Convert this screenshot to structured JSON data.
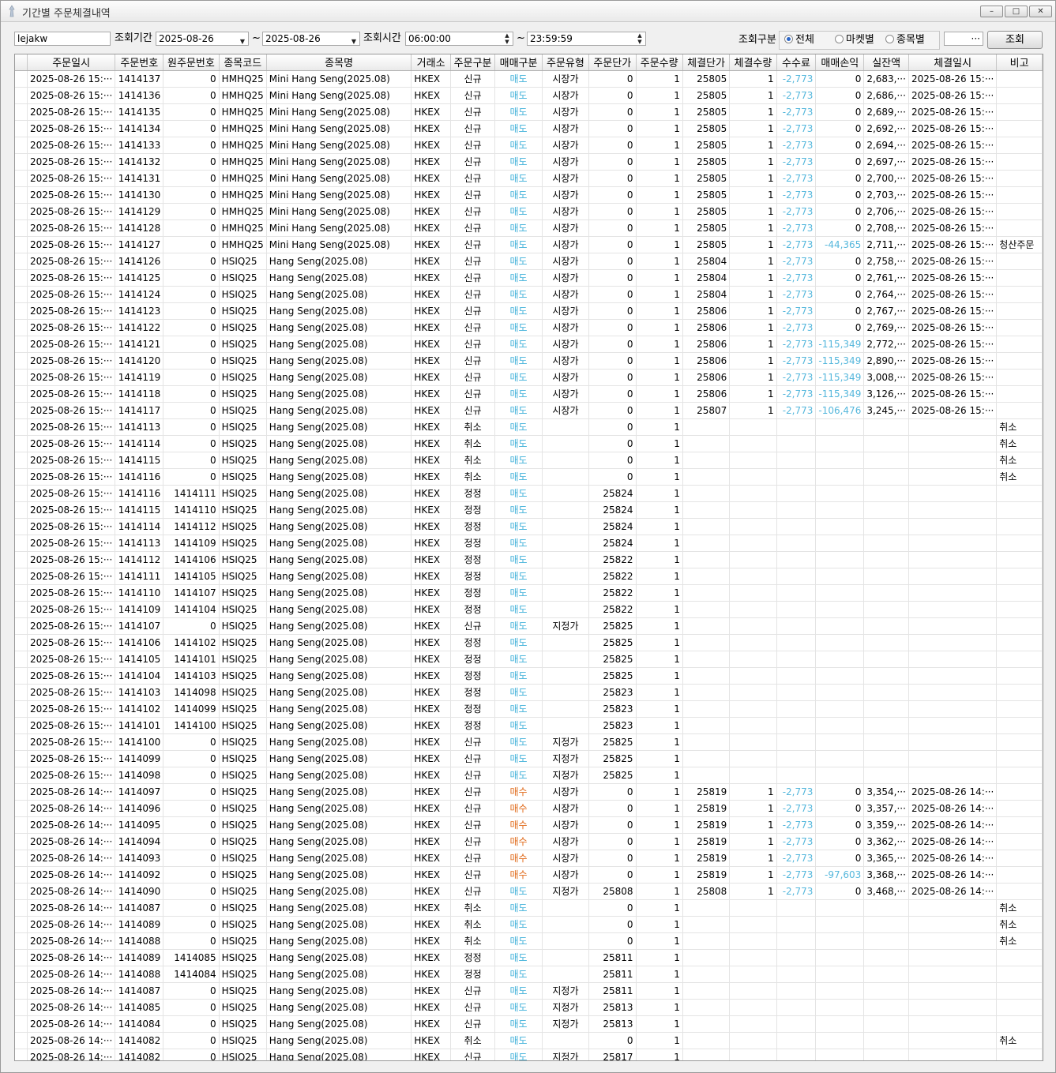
{
  "window": {
    "title": "기간별 주문체결내역",
    "controls": [
      "–",
      "□",
      "✕"
    ]
  },
  "toolbar": {
    "account": "lejakw",
    "period_label": "조회기간",
    "date_from": "2025-08-26",
    "tilde": "~",
    "date_to": "2025-08-26",
    "time_label": "조회시간",
    "time_from": "06:00:00",
    "time_to": "23:59:59",
    "mode_label": "조회구분",
    "mode_options": [
      "전체",
      "마켓별",
      "종목별"
    ],
    "mode_selected": "전체",
    "ellipsis": "···",
    "query_button": "조회"
  },
  "grid": {
    "columns": [
      "주문일시",
      "주문번호",
      "원주문번호",
      "종목코드",
      "종목명",
      "거래소",
      "주문구분",
      "매매구분",
      "주문유형",
      "주문단가",
      "주문수량",
      "체결단가",
      "체결수량",
      "수수료",
      "매매손익",
      "실잔액",
      "체결일시",
      "비고"
    ],
    "rows": [
      [
        "2025-08-26 15:···",
        "1414137",
        "0",
        "HMHQ25",
        "Mini Hang Seng(2025.08)",
        "HKEX",
        "신규",
        "매도",
        "시장가",
        "0",
        "1",
        "25805",
        "1",
        "-2,773",
        "0",
        "2,683,···",
        "2025-08-26 15:···",
        ""
      ],
      [
        "2025-08-26 15:···",
        "1414136",
        "0",
        "HMHQ25",
        "Mini Hang Seng(2025.08)",
        "HKEX",
        "신규",
        "매도",
        "시장가",
        "0",
        "1",
        "25805",
        "1",
        "-2,773",
        "0",
        "2,686,···",
        "2025-08-26 15:···",
        ""
      ],
      [
        "2025-08-26 15:···",
        "1414135",
        "0",
        "HMHQ25",
        "Mini Hang Seng(2025.08)",
        "HKEX",
        "신규",
        "매도",
        "시장가",
        "0",
        "1",
        "25805",
        "1",
        "-2,773",
        "0",
        "2,689,···",
        "2025-08-26 15:···",
        ""
      ],
      [
        "2025-08-26 15:···",
        "1414134",
        "0",
        "HMHQ25",
        "Mini Hang Seng(2025.08)",
        "HKEX",
        "신규",
        "매도",
        "시장가",
        "0",
        "1",
        "25805",
        "1",
        "-2,773",
        "0",
        "2,692,···",
        "2025-08-26 15:···",
        ""
      ],
      [
        "2025-08-26 15:···",
        "1414133",
        "0",
        "HMHQ25",
        "Mini Hang Seng(2025.08)",
        "HKEX",
        "신규",
        "매도",
        "시장가",
        "0",
        "1",
        "25805",
        "1",
        "-2,773",
        "0",
        "2,694,···",
        "2025-08-26 15:···",
        ""
      ],
      [
        "2025-08-26 15:···",
        "1414132",
        "0",
        "HMHQ25",
        "Mini Hang Seng(2025.08)",
        "HKEX",
        "신규",
        "매도",
        "시장가",
        "0",
        "1",
        "25805",
        "1",
        "-2,773",
        "0",
        "2,697,···",
        "2025-08-26 15:···",
        ""
      ],
      [
        "2025-08-26 15:···",
        "1414131",
        "0",
        "HMHQ25",
        "Mini Hang Seng(2025.08)",
        "HKEX",
        "신규",
        "매도",
        "시장가",
        "0",
        "1",
        "25805",
        "1",
        "-2,773",
        "0",
        "2,700,···",
        "2025-08-26 15:···",
        ""
      ],
      [
        "2025-08-26 15:···",
        "1414130",
        "0",
        "HMHQ25",
        "Mini Hang Seng(2025.08)",
        "HKEX",
        "신규",
        "매도",
        "시장가",
        "0",
        "1",
        "25805",
        "1",
        "-2,773",
        "0",
        "2,703,···",
        "2025-08-26 15:···",
        ""
      ],
      [
        "2025-08-26 15:···",
        "1414129",
        "0",
        "HMHQ25",
        "Mini Hang Seng(2025.08)",
        "HKEX",
        "신규",
        "매도",
        "시장가",
        "0",
        "1",
        "25805",
        "1",
        "-2,773",
        "0",
        "2,706,···",
        "2025-08-26 15:···",
        ""
      ],
      [
        "2025-08-26 15:···",
        "1414128",
        "0",
        "HMHQ25",
        "Mini Hang Seng(2025.08)",
        "HKEX",
        "신규",
        "매도",
        "시장가",
        "0",
        "1",
        "25805",
        "1",
        "-2,773",
        "0",
        "2,708,···",
        "2025-08-26 15:···",
        ""
      ],
      [
        "2025-08-26 15:···",
        "1414127",
        "0",
        "HMHQ25",
        "Mini Hang Seng(2025.08)",
        "HKEX",
        "신규",
        "매도",
        "시장가",
        "0",
        "1",
        "25805",
        "1",
        "-2,773",
        "-44,365",
        "2,711,···",
        "2025-08-26 15:···",
        "청산주문"
      ],
      [
        "2025-08-26 15:···",
        "1414126",
        "0",
        "HSIQ25",
        "Hang Seng(2025.08)",
        "HKEX",
        "신규",
        "매도",
        "시장가",
        "0",
        "1",
        "25804",
        "1",
        "-2,773",
        "0",
        "2,758,···",
        "2025-08-26 15:···",
        ""
      ],
      [
        "2025-08-26 15:···",
        "1414125",
        "0",
        "HSIQ25",
        "Hang Seng(2025.08)",
        "HKEX",
        "신규",
        "매도",
        "시장가",
        "0",
        "1",
        "25804",
        "1",
        "-2,773",
        "0",
        "2,761,···",
        "2025-08-26 15:···",
        ""
      ],
      [
        "2025-08-26 15:···",
        "1414124",
        "0",
        "HSIQ25",
        "Hang Seng(2025.08)",
        "HKEX",
        "신규",
        "매도",
        "시장가",
        "0",
        "1",
        "25804",
        "1",
        "-2,773",
        "0",
        "2,764,···",
        "2025-08-26 15:···",
        ""
      ],
      [
        "2025-08-26 15:···",
        "1414123",
        "0",
        "HSIQ25",
        "Hang Seng(2025.08)",
        "HKEX",
        "신규",
        "매도",
        "시장가",
        "0",
        "1",
        "25806",
        "1",
        "-2,773",
        "0",
        "2,767,···",
        "2025-08-26 15:···",
        ""
      ],
      [
        "2025-08-26 15:···",
        "1414122",
        "0",
        "HSIQ25",
        "Hang Seng(2025.08)",
        "HKEX",
        "신규",
        "매도",
        "시장가",
        "0",
        "1",
        "25806",
        "1",
        "-2,773",
        "0",
        "2,769,···",
        "2025-08-26 15:···",
        ""
      ],
      [
        "2025-08-26 15:···",
        "1414121",
        "0",
        "HSIQ25",
        "Hang Seng(2025.08)",
        "HKEX",
        "신규",
        "매도",
        "시장가",
        "0",
        "1",
        "25806",
        "1",
        "-2,773",
        "-115,349",
        "2,772,···",
        "2025-08-26 15:···",
        ""
      ],
      [
        "2025-08-26 15:···",
        "1414120",
        "0",
        "HSIQ25",
        "Hang Seng(2025.08)",
        "HKEX",
        "신규",
        "매도",
        "시장가",
        "0",
        "1",
        "25806",
        "1",
        "-2,773",
        "-115,349",
        "2,890,···",
        "2025-08-26 15:···",
        ""
      ],
      [
        "2025-08-26 15:···",
        "1414119",
        "0",
        "HSIQ25",
        "Hang Seng(2025.08)",
        "HKEX",
        "신규",
        "매도",
        "시장가",
        "0",
        "1",
        "25806",
        "1",
        "-2,773",
        "-115,349",
        "3,008,···",
        "2025-08-26 15:···",
        ""
      ],
      [
        "2025-08-26 15:···",
        "1414118",
        "0",
        "HSIQ25",
        "Hang Seng(2025.08)",
        "HKEX",
        "신규",
        "매도",
        "시장가",
        "0",
        "1",
        "25806",
        "1",
        "-2,773",
        "-115,349",
        "3,126,···",
        "2025-08-26 15:···",
        ""
      ],
      [
        "2025-08-26 15:···",
        "1414117",
        "0",
        "HSIQ25",
        "Hang Seng(2025.08)",
        "HKEX",
        "신규",
        "매도",
        "시장가",
        "0",
        "1",
        "25807",
        "1",
        "-2,773",
        "-106,476",
        "3,245,···",
        "2025-08-26 15:···",
        ""
      ],
      [
        "2025-08-26 15:···",
        "1414113",
        "0",
        "HSIQ25",
        "Hang Seng(2025.08)",
        "HKEX",
        "취소",
        "매도",
        "",
        "0",
        "1",
        "",
        "",
        "",
        "",
        "",
        "",
        "취소"
      ],
      [
        "2025-08-26 15:···",
        "1414114",
        "0",
        "HSIQ25",
        "Hang Seng(2025.08)",
        "HKEX",
        "취소",
        "매도",
        "",
        "0",
        "1",
        "",
        "",
        "",
        "",
        "",
        "",
        "취소"
      ],
      [
        "2025-08-26 15:···",
        "1414115",
        "0",
        "HSIQ25",
        "Hang Seng(2025.08)",
        "HKEX",
        "취소",
        "매도",
        "",
        "0",
        "1",
        "",
        "",
        "",
        "",
        "",
        "",
        "취소"
      ],
      [
        "2025-08-26 15:···",
        "1414116",
        "0",
        "HSIQ25",
        "Hang Seng(2025.08)",
        "HKEX",
        "취소",
        "매도",
        "",
        "0",
        "1",
        "",
        "",
        "",
        "",
        "",
        "",
        "취소"
      ],
      [
        "2025-08-26 15:···",
        "1414116",
        "1414111",
        "HSIQ25",
        "Hang Seng(2025.08)",
        "HKEX",
        "정정",
        "매도",
        "",
        "25824",
        "1",
        "",
        "",
        "",
        "",
        "",
        "",
        ""
      ],
      [
        "2025-08-26 15:···",
        "1414115",
        "1414110",
        "HSIQ25",
        "Hang Seng(2025.08)",
        "HKEX",
        "정정",
        "매도",
        "",
        "25824",
        "1",
        "",
        "",
        "",
        "",
        "",
        "",
        ""
      ],
      [
        "2025-08-26 15:···",
        "1414114",
        "1414112",
        "HSIQ25",
        "Hang Seng(2025.08)",
        "HKEX",
        "정정",
        "매도",
        "",
        "25824",
        "1",
        "",
        "",
        "",
        "",
        "",
        "",
        ""
      ],
      [
        "2025-08-26 15:···",
        "1414113",
        "1414109",
        "HSIQ25",
        "Hang Seng(2025.08)",
        "HKEX",
        "정정",
        "매도",
        "",
        "25824",
        "1",
        "",
        "",
        "",
        "",
        "",
        "",
        ""
      ],
      [
        "2025-08-26 15:···",
        "1414112",
        "1414106",
        "HSIQ25",
        "Hang Seng(2025.08)",
        "HKEX",
        "정정",
        "매도",
        "",
        "25822",
        "1",
        "",
        "",
        "",
        "",
        "",
        "",
        ""
      ],
      [
        "2025-08-26 15:···",
        "1414111",
        "1414105",
        "HSIQ25",
        "Hang Seng(2025.08)",
        "HKEX",
        "정정",
        "매도",
        "",
        "25822",
        "1",
        "",
        "",
        "",
        "",
        "",
        "",
        ""
      ],
      [
        "2025-08-26 15:···",
        "1414110",
        "1414107",
        "HSIQ25",
        "Hang Seng(2025.08)",
        "HKEX",
        "정정",
        "매도",
        "",
        "25822",
        "1",
        "",
        "",
        "",
        "",
        "",
        "",
        ""
      ],
      [
        "2025-08-26 15:···",
        "1414109",
        "1414104",
        "HSIQ25",
        "Hang Seng(2025.08)",
        "HKEX",
        "정정",
        "매도",
        "",
        "25822",
        "1",
        "",
        "",
        "",
        "",
        "",
        "",
        ""
      ],
      [
        "2025-08-26 15:···",
        "1414107",
        "0",
        "HSIQ25",
        "Hang Seng(2025.08)",
        "HKEX",
        "신규",
        "매도",
        "지정가",
        "25825",
        "1",
        "",
        "",
        "",
        "",
        "",
        "",
        ""
      ],
      [
        "2025-08-26 15:···",
        "1414106",
        "1414102",
        "HSIQ25",
        "Hang Seng(2025.08)",
        "HKEX",
        "정정",
        "매도",
        "",
        "25825",
        "1",
        "",
        "",
        "",
        "",
        "",
        "",
        ""
      ],
      [
        "2025-08-26 15:···",
        "1414105",
        "1414101",
        "HSIQ25",
        "Hang Seng(2025.08)",
        "HKEX",
        "정정",
        "매도",
        "",
        "25825",
        "1",
        "",
        "",
        "",
        "",
        "",
        "",
        ""
      ],
      [
        "2025-08-26 15:···",
        "1414104",
        "1414103",
        "HSIQ25",
        "Hang Seng(2025.08)",
        "HKEX",
        "정정",
        "매도",
        "",
        "25825",
        "1",
        "",
        "",
        "",
        "",
        "",
        "",
        ""
      ],
      [
        "2025-08-26 15:···",
        "1414103",
        "1414098",
        "HSIQ25",
        "Hang Seng(2025.08)",
        "HKEX",
        "정정",
        "매도",
        "",
        "25823",
        "1",
        "",
        "",
        "",
        "",
        "",
        "",
        ""
      ],
      [
        "2025-08-26 15:···",
        "1414102",
        "1414099",
        "HSIQ25",
        "Hang Seng(2025.08)",
        "HKEX",
        "정정",
        "매도",
        "",
        "25823",
        "1",
        "",
        "",
        "",
        "",
        "",
        "",
        ""
      ],
      [
        "2025-08-26 15:···",
        "1414101",
        "1414100",
        "HSIQ25",
        "Hang Seng(2025.08)",
        "HKEX",
        "정정",
        "매도",
        "",
        "25823",
        "1",
        "",
        "",
        "",
        "",
        "",
        "",
        ""
      ],
      [
        "2025-08-26 15:···",
        "1414100",
        "0",
        "HSIQ25",
        "Hang Seng(2025.08)",
        "HKEX",
        "신규",
        "매도",
        "지정가",
        "25825",
        "1",
        "",
        "",
        "",
        "",
        "",
        "",
        ""
      ],
      [
        "2025-08-26 15:···",
        "1414099",
        "0",
        "HSIQ25",
        "Hang Seng(2025.08)",
        "HKEX",
        "신규",
        "매도",
        "지정가",
        "25825",
        "1",
        "",
        "",
        "",
        "",
        "",
        "",
        ""
      ],
      [
        "2025-08-26 15:···",
        "1414098",
        "0",
        "HSIQ25",
        "Hang Seng(2025.08)",
        "HKEX",
        "신규",
        "매도",
        "지정가",
        "25825",
        "1",
        "",
        "",
        "",
        "",
        "",
        "",
        ""
      ],
      [
        "2025-08-26 14:···",
        "1414097",
        "0",
        "HSIQ25",
        "Hang Seng(2025.08)",
        "HKEX",
        "신규",
        "매수",
        "시장가",
        "0",
        "1",
        "25819",
        "1",
        "-2,773",
        "0",
        "3,354,···",
        "2025-08-26 14:···",
        ""
      ],
      [
        "2025-08-26 14:···",
        "1414096",
        "0",
        "HSIQ25",
        "Hang Seng(2025.08)",
        "HKEX",
        "신규",
        "매수",
        "시장가",
        "0",
        "1",
        "25819",
        "1",
        "-2,773",
        "0",
        "3,357,···",
        "2025-08-26 14:···",
        ""
      ],
      [
        "2025-08-26 14:···",
        "1414095",
        "0",
        "HSIQ25",
        "Hang Seng(2025.08)",
        "HKEX",
        "신규",
        "매수",
        "시장가",
        "0",
        "1",
        "25819",
        "1",
        "-2,773",
        "0",
        "3,359,···",
        "2025-08-26 14:···",
        ""
      ],
      [
        "2025-08-26 14:···",
        "1414094",
        "0",
        "HSIQ25",
        "Hang Seng(2025.08)",
        "HKEX",
        "신규",
        "매수",
        "시장가",
        "0",
        "1",
        "25819",
        "1",
        "-2,773",
        "0",
        "3,362,···",
        "2025-08-26 14:···",
        ""
      ],
      [
        "2025-08-26 14:···",
        "1414093",
        "0",
        "HSIQ25",
        "Hang Seng(2025.08)",
        "HKEX",
        "신규",
        "매수",
        "시장가",
        "0",
        "1",
        "25819",
        "1",
        "-2,773",
        "0",
        "3,365,···",
        "2025-08-26 14:···",
        ""
      ],
      [
        "2025-08-26 14:···",
        "1414092",
        "0",
        "HSIQ25",
        "Hang Seng(2025.08)",
        "HKEX",
        "신규",
        "매수",
        "시장가",
        "0",
        "1",
        "25819",
        "1",
        "-2,773",
        "-97,603",
        "3,368,···",
        "2025-08-26 14:···",
        ""
      ],
      [
        "2025-08-26 14:···",
        "1414090",
        "0",
        "HSIQ25",
        "Hang Seng(2025.08)",
        "HKEX",
        "신규",
        "매도",
        "지정가",
        "25808",
        "1",
        "25808",
        "1",
        "-2,773",
        "0",
        "3,468,···",
        "2025-08-26 14:···",
        ""
      ],
      [
        "2025-08-26 14:···",
        "1414087",
        "0",
        "HSIQ25",
        "Hang Seng(2025.08)",
        "HKEX",
        "취소",
        "매도",
        "",
        "0",
        "1",
        "",
        "",
        "",
        "",
        "",
        "",
        "취소"
      ],
      [
        "2025-08-26 14:···",
        "1414089",
        "0",
        "HSIQ25",
        "Hang Seng(2025.08)",
        "HKEX",
        "취소",
        "매도",
        "",
        "0",
        "1",
        "",
        "",
        "",
        "",
        "",
        "",
        "취소"
      ],
      [
        "2025-08-26 14:···",
        "1414088",
        "0",
        "HSIQ25",
        "Hang Seng(2025.08)",
        "HKEX",
        "취소",
        "매도",
        "",
        "0",
        "1",
        "",
        "",
        "",
        "",
        "",
        "",
        "취소"
      ],
      [
        "2025-08-26 14:···",
        "1414089",
        "1414085",
        "HSIQ25",
        "Hang Seng(2025.08)",
        "HKEX",
        "정정",
        "매도",
        "",
        "25811",
        "1",
        "",
        "",
        "",
        "",
        "",
        "",
        ""
      ],
      [
        "2025-08-26 14:···",
        "1414088",
        "1414084",
        "HSIQ25",
        "Hang Seng(2025.08)",
        "HKEX",
        "정정",
        "매도",
        "",
        "25811",
        "1",
        "",
        "",
        "",
        "",
        "",
        "",
        ""
      ],
      [
        "2025-08-26 14:···",
        "1414087",
        "0",
        "HSIQ25",
        "Hang Seng(2025.08)",
        "HKEX",
        "신규",
        "매도",
        "지정가",
        "25811",
        "1",
        "",
        "",
        "",
        "",
        "",
        "",
        ""
      ],
      [
        "2025-08-26 14:···",
        "1414085",
        "0",
        "HSIQ25",
        "Hang Seng(2025.08)",
        "HKEX",
        "신규",
        "매도",
        "지정가",
        "25813",
        "1",
        "",
        "",
        "",
        "",
        "",
        "",
        ""
      ],
      [
        "2025-08-26 14:···",
        "1414084",
        "0",
        "HSIQ25",
        "Hang Seng(2025.08)",
        "HKEX",
        "신규",
        "매도",
        "지정가",
        "25813",
        "1",
        "",
        "",
        "",
        "",
        "",
        "",
        ""
      ],
      [
        "2025-08-26 14:···",
        "1414082",
        "0",
        "HSIQ25",
        "Hang Seng(2025.08)",
        "HKEX",
        "취소",
        "매도",
        "",
        "0",
        "1",
        "",
        "",
        "",
        "",
        "",
        "",
        "취소"
      ],
      [
        "2025-08-26 14:···",
        "1414082",
        "0",
        "HSIQ25",
        "Hang Seng(2025.08)",
        "HKEX",
        "신규",
        "매도",
        "지정가",
        "25817",
        "1",
        "",
        "",
        "",
        "",
        "",
        "",
        ""
      ]
    ]
  },
  "colors": {
    "sell": "#3fb0d9",
    "buy": "#e06a1a",
    "negative": "#55b7dc"
  }
}
